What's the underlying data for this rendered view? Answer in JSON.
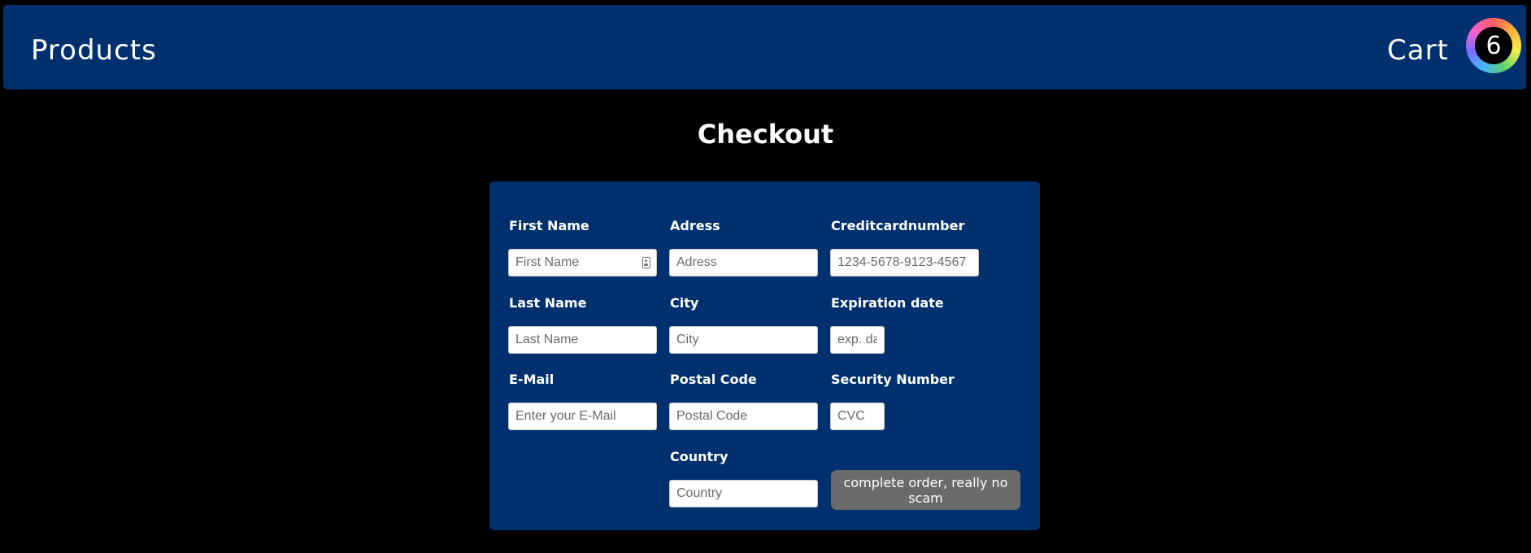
{
  "nav": {
    "products_label": "Products",
    "cart_label": "Cart",
    "cart_count": "6"
  },
  "page": {
    "title": "Checkout"
  },
  "form": {
    "first_name": {
      "label": "First Name",
      "placeholder": "First Name",
      "value": ""
    },
    "last_name": {
      "label": "Last Name",
      "placeholder": "Last Name",
      "value": ""
    },
    "email": {
      "label": "E-Mail",
      "placeholder": "Enter your E-Mail",
      "value": ""
    },
    "address": {
      "label": "Adress",
      "placeholder": "Adress",
      "value": ""
    },
    "city": {
      "label": "City",
      "placeholder": "City",
      "value": ""
    },
    "postal_code": {
      "label": "Postal Code",
      "placeholder": "Postal Code",
      "value": ""
    },
    "country": {
      "label": "Country",
      "placeholder": "Country",
      "value": ""
    },
    "card_number": {
      "label": "Creditcardnumber",
      "placeholder": "1234-5678-9123-4567",
      "value": ""
    },
    "expiration": {
      "label": "Expiration date",
      "placeholder": "exp. date",
      "value": ""
    },
    "security": {
      "label": "Security Number",
      "placeholder": "CVC",
      "value": ""
    },
    "submit_label": "complete order, really no scam"
  },
  "colors": {
    "panel": "#00306e",
    "background": "#000000",
    "button": "#6b6b6b"
  },
  "icons": {
    "autofill": "contact-card-icon"
  }
}
